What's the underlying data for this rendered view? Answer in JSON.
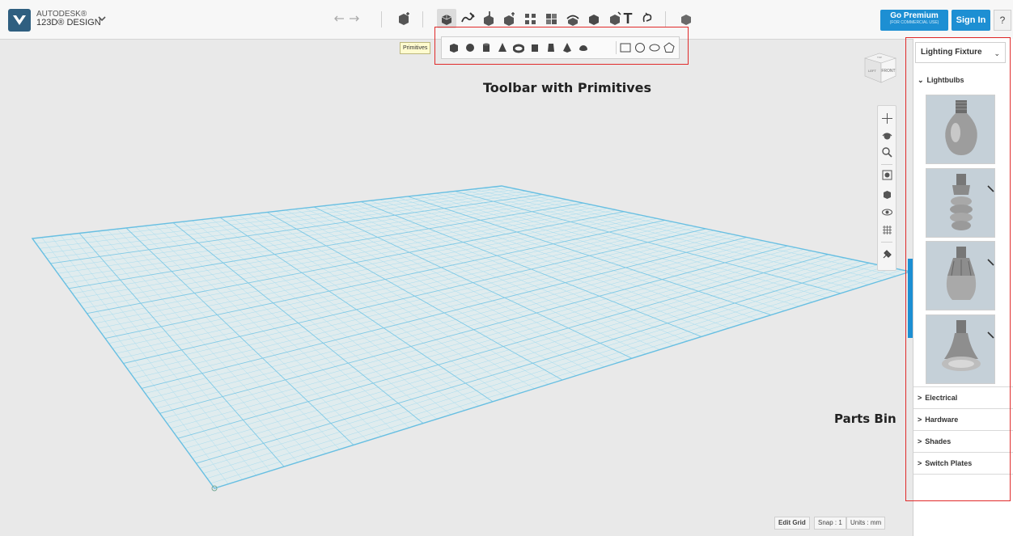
{
  "app": {
    "brand_line1": "AUTODESK®",
    "brand_line2": "123D® DESIGN"
  },
  "header": {
    "premium_label": "Go Premium",
    "premium_sub": "(FOR COMMERCIAL USE)",
    "signin_label": "Sign In",
    "help_label": "?"
  },
  "toolbar": {
    "icons": [
      "primitives-icon",
      "sketch-icon",
      "construct-icon",
      "modify-icon",
      "pattern-icon",
      "group-icon",
      "combine-icon",
      "measure-icon",
      "text-icon",
      "snap-icon",
      "material-icon"
    ],
    "text_tool_label": "T",
    "tooltip": "Primitives"
  },
  "primitives": {
    "solids": [
      "box",
      "sphere",
      "cylinder",
      "cone",
      "torus",
      "wedge",
      "prism",
      "pyramid",
      "hemisphere"
    ],
    "shapes": [
      "rectangle",
      "circle",
      "ellipse",
      "polygon"
    ]
  },
  "annotations": {
    "toolbar": "Toolbar with Primitives",
    "bin": "Parts Bin"
  },
  "viewcube": {
    "front": "FRONT",
    "left": "LEFT",
    "top": "TOP"
  },
  "navbar": {
    "icons": [
      "pan-icon",
      "orbit-icon",
      "zoom-icon",
      "fit-icon",
      "view-icon",
      "visibility-icon",
      "grid-icon",
      "material-icon"
    ]
  },
  "status": {
    "edit_grid": "Edit Grid",
    "snap": "Snap : 1",
    "units": "Units : mm"
  },
  "parts_bin": {
    "selected": "Lighting Fixture",
    "open_category": "Lightbulbs",
    "items": [
      "incandescent-bulb",
      "spiral-cfl-bulb",
      "led-bulb",
      "reflector-bulb"
    ],
    "categories": [
      "Electrical",
      "Hardware",
      "Shades",
      "Switch Plates"
    ]
  },
  "colors": {
    "accent": "#1d8fd3",
    "grid": "#7ec9e6",
    "highlight": "#e02a2a"
  }
}
